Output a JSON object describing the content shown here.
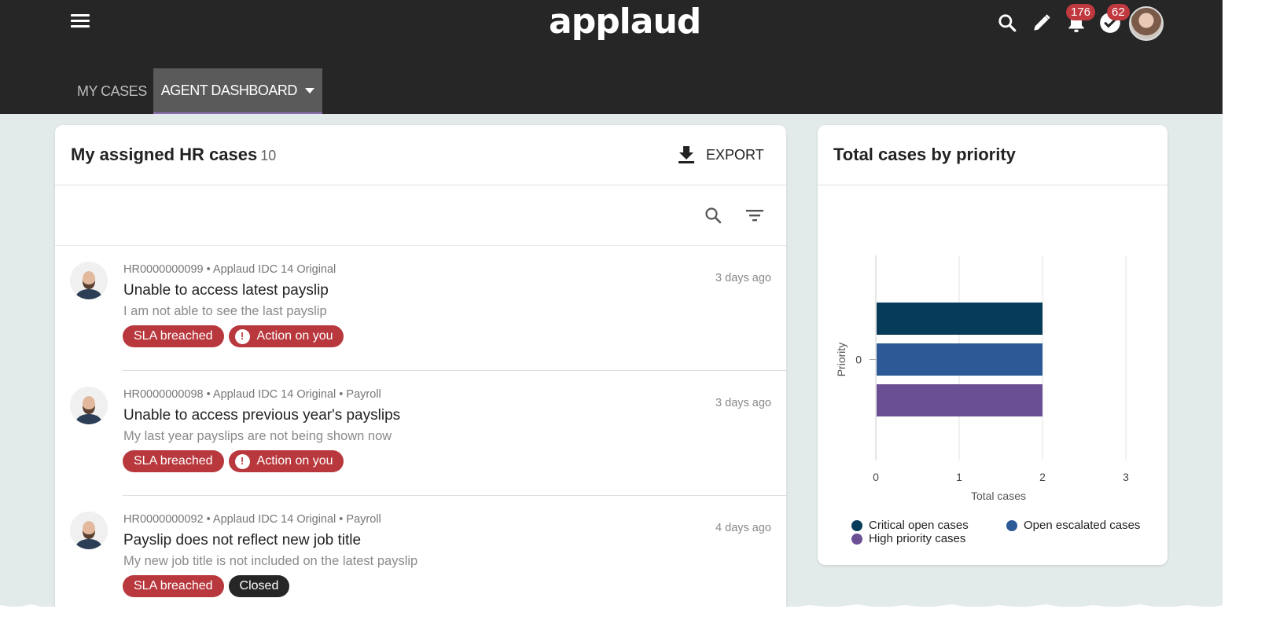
{
  "header": {
    "logo": "applaud",
    "notifications_count": "176",
    "tasks_count": "62",
    "tabs": [
      {
        "label": "MY CASES"
      },
      {
        "label": "AGENT DASHBOARD"
      }
    ]
  },
  "cases_card": {
    "title": "My assigned HR cases",
    "count": "10",
    "export_label": "EXPORT",
    "cases": [
      {
        "meta": "HR0000000099 • Applaud IDC 14 Original",
        "title": "Unable to access latest payslip",
        "description": "I am not able to see the last payslip",
        "time": "3 days ago",
        "tag1": "SLA breached",
        "tag2": "Action on you"
      },
      {
        "meta": "HR0000000098 • Applaud IDC 14 Original • Payroll",
        "title": "Unable to access previous year's payslips",
        "description": "My last year payslips are not being shown now",
        "time": "3 days ago",
        "tag1": "SLA breached",
        "tag2": "Action on you"
      },
      {
        "meta": "HR0000000092 • Applaud IDC 14 Original • Payroll",
        "title": "Payslip does not reflect new job title",
        "description": "My new job title is not included on the latest payslip",
        "time": "4 days ago",
        "tag1": "SLA breached",
        "tag2": "Closed"
      }
    ]
  },
  "chart_card": {
    "title": "Total cases by priority"
  },
  "chart_data": {
    "type": "bar",
    "orientation": "horizontal",
    "title": "Total cases by priority",
    "xlabel": "Total cases",
    "ylabel": "Priority",
    "categories": [
      "0"
    ],
    "xlim": [
      0,
      3
    ],
    "xticks": [
      "0",
      "1",
      "2",
      "3"
    ],
    "grid": true,
    "legend_position": "bottom",
    "series": [
      {
        "name": "Critical open cases",
        "values": [
          2
        ],
        "color": "#073b5a"
      },
      {
        "name": "Open escalated cases",
        "values": [
          2
        ],
        "color": "#2d5a96"
      },
      {
        "name": "High priority cases",
        "values": [
          2
        ],
        "color": "#6b4f95"
      }
    ]
  },
  "colors": {
    "header_bg": "#262626",
    "badge": "#c0393f",
    "tag_red": "#b8383d",
    "tag_dark": "#262626",
    "page_bg": "#e2eaea"
  },
  "icons": {
    "menu": "hamburger-menu-icon",
    "search": "search-icon",
    "edit": "pencil-icon",
    "notifications": "bell-icon",
    "tasks": "check-circle-icon",
    "export": "download-icon",
    "filter": "filter-icon",
    "alert": "exclamation-icon"
  }
}
